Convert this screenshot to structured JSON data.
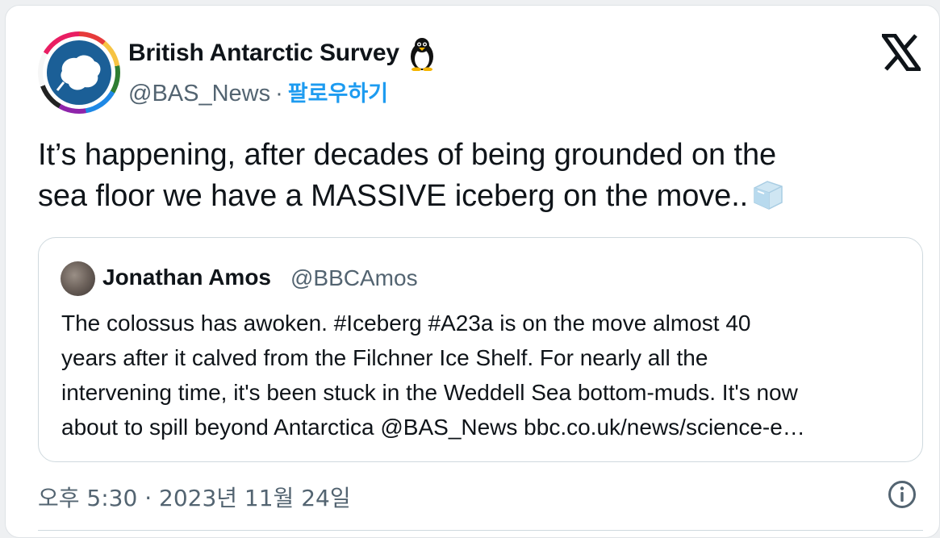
{
  "tweet": {
    "author": {
      "display_name": "British Antarctic Survey",
      "handle": "@BAS_News",
      "separator": "·",
      "follow_label": "팔로우하기",
      "avatar_icon": "antarctica-logo-icon",
      "name_emoji_icon": "penguin-icon"
    },
    "platform_icon": "x-logo-icon",
    "text_lines": [
      "It’s happening, after decades of being grounded on the",
      "sea floor we have a MASSIVE iceberg on the move.."
    ],
    "text_emoji_icon": "ice-cube-icon",
    "quote": {
      "display_name": "Jonathan Amos",
      "handle": "@BBCAmos",
      "lines": [
        "The colossus has awoken. #Iceberg #A23a is on the move almost 40",
        "years after it calved from the Filchner Ice Shelf. For nearly all the",
        "intervening time, it's been stuck in the Weddell Sea bottom-muds. It's now",
        "about to spill beyond Antarctica @BAS_News bbc.co.uk/news/science-e…"
      ]
    },
    "timestamp": "오후 5:30 · 2023년 11월 24일",
    "info_icon": "info-icon"
  },
  "colors": {
    "accent": "#1d9bf0",
    "secondary_text": "#536471",
    "avatar_blue": "#1b5f97"
  }
}
